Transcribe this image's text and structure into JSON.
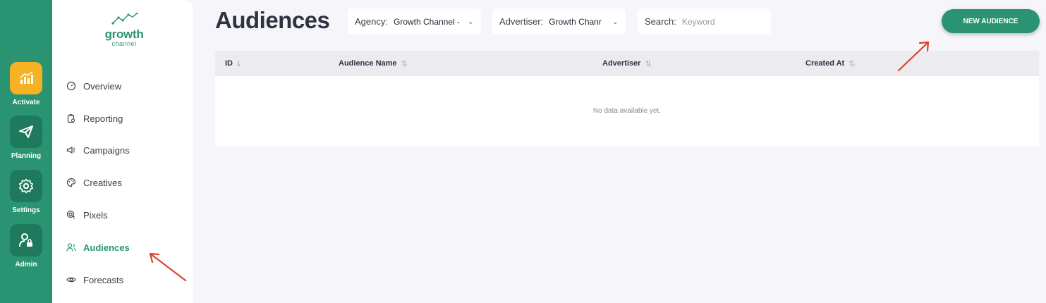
{
  "rail": {
    "items": [
      {
        "label": "Activate",
        "icon": "chart-bars-icon",
        "active": true
      },
      {
        "label": "Planning",
        "icon": "paper-plane-icon",
        "active": false
      },
      {
        "label": "Settings",
        "icon": "gear-icon",
        "active": false
      },
      {
        "label": "Admin",
        "icon": "user-lock-icon",
        "active": false
      }
    ]
  },
  "brand": {
    "name": "growth",
    "sub": "channel"
  },
  "sidebar": {
    "items": [
      {
        "label": "Overview",
        "icon": "speedometer-icon"
      },
      {
        "label": "Reporting",
        "icon": "clipboard-icon"
      },
      {
        "label": "Campaigns",
        "icon": "megaphone-icon"
      },
      {
        "label": "Creatives",
        "icon": "palette-icon"
      },
      {
        "label": "Pixels",
        "icon": "target-cursor-icon"
      },
      {
        "label": "Audiences",
        "icon": "users-icon",
        "active": true
      },
      {
        "label": "Forecasts",
        "icon": "eye-icon"
      }
    ]
  },
  "header": {
    "title": "Audiences",
    "agency": {
      "label": "Agency:",
      "value": "Growth Channel -"
    },
    "advertiser": {
      "label": "Advertiser:",
      "value": "Growth Chanr"
    },
    "search": {
      "label": "Search:",
      "placeholder": "Keyword"
    },
    "new_button": "NEW AUDIENCE"
  },
  "table": {
    "columns": [
      {
        "label": "ID",
        "sort": "↓"
      },
      {
        "label": "Audience Name",
        "sort": "⇅"
      },
      {
        "label": "Advertiser",
        "sort": "⇅"
      },
      {
        "label": "Created At",
        "sort": "⇅"
      }
    ],
    "empty_text": "No data available yet."
  },
  "colors": {
    "brand": "#2a9472",
    "accent": "#f6b223",
    "annotation": "#d9442a"
  }
}
